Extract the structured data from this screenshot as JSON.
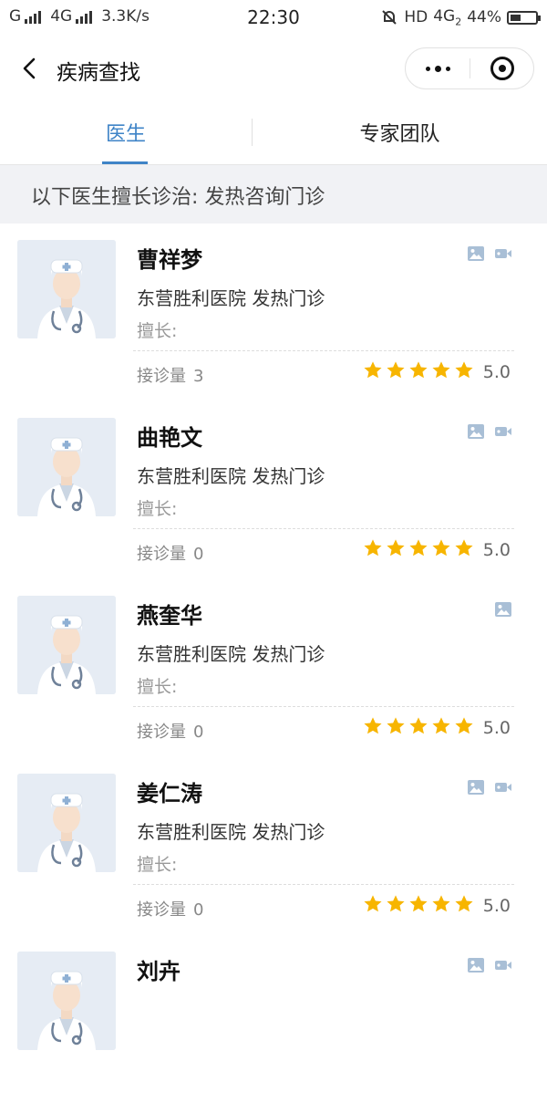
{
  "status_bar": {
    "left_text": "G",
    "network": "4G",
    "speed": "3.3K/s",
    "time": "22:30",
    "right_text": "HD",
    "right_network": "4G",
    "right_network_sub": "2",
    "battery": "44%",
    "battery_level": 0.44
  },
  "nav": {
    "title": "疾病查找",
    "back_icon": "chevron-left-icon",
    "more_icon": "more-dots-icon",
    "close_icon": "target-circle-icon"
  },
  "tabs": [
    {
      "label": "医生",
      "active": true
    },
    {
      "label": "专家团队",
      "active": false
    }
  ],
  "banner": {
    "text": "以下医生擅长诊治: 发热咨询门诊"
  },
  "colors": {
    "accent": "#3f84c7",
    "star": "#f7b500",
    "media_icon": "#a9bfd6"
  },
  "doctors": [
    {
      "name": "曹祥梦",
      "hospital": "东营胜利医院 发热门诊",
      "specialty_label": "擅长:",
      "consult_label": "接诊量",
      "consult_count": "3",
      "rating": "5.0",
      "stars": 5,
      "has_image": true,
      "has_video": true
    },
    {
      "name": "曲艳文",
      "hospital": "东营胜利医院 发热门诊",
      "specialty_label": "擅长:",
      "consult_label": "接诊量",
      "consult_count": "0",
      "rating": "5.0",
      "stars": 5,
      "has_image": true,
      "has_video": true
    },
    {
      "name": "燕奎华",
      "hospital": "东营胜利医院 发热门诊",
      "specialty_label": "擅长:",
      "consult_label": "接诊量",
      "consult_count": "0",
      "rating": "5.0",
      "stars": 5,
      "has_image": true,
      "has_video": false
    },
    {
      "name": "姜仁涛",
      "hospital": "东营胜利医院 发热门诊",
      "specialty_label": "擅长:",
      "consult_label": "接诊量",
      "consult_count": "0",
      "rating": "5.0",
      "stars": 5,
      "has_image": true,
      "has_video": true
    },
    {
      "name": "刘卉",
      "hospital": "",
      "specialty_label": "",
      "consult_label": "",
      "consult_count": "",
      "rating": "",
      "stars": 0,
      "has_image": true,
      "has_video": true
    }
  ]
}
